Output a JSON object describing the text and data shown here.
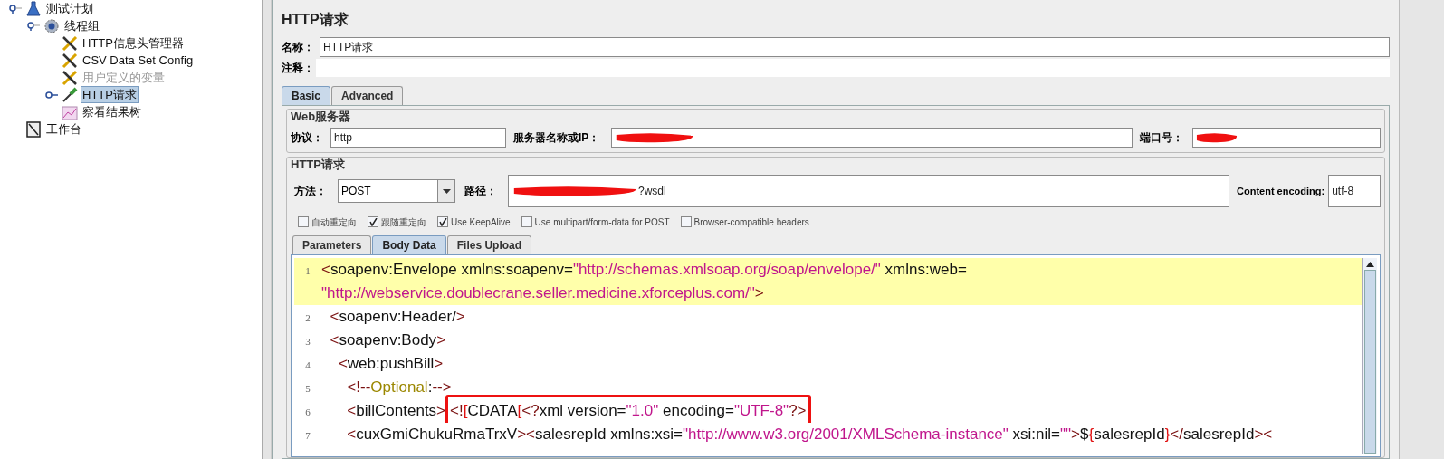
{
  "tree": [
    {
      "label": "测试计划",
      "kind": "flask",
      "expanded": true,
      "selected": false,
      "disabled": false,
      "children": [
        {
          "label": "线程组",
          "kind": "gear",
          "expanded": true,
          "selected": false,
          "disabled": false,
          "children": [
            {
              "label": "HTTP信息头管理器",
              "kind": "tools",
              "selected": false,
              "disabled": false
            },
            {
              "label": "CSV Data Set Config",
              "kind": "tools",
              "selected": false,
              "disabled": false
            },
            {
              "label": "用户定义的变量",
              "kind": "tools",
              "selected": false,
              "disabled": true
            },
            {
              "label": "HTTP请求",
              "kind": "pipette",
              "expanded": false,
              "selected": true,
              "disabled": false
            },
            {
              "label": "察看结果树",
              "kind": "chart",
              "selected": false,
              "disabled": false
            }
          ]
        }
      ]
    },
    {
      "label": "工作台",
      "kind": "notebook",
      "selected": false,
      "disabled": false
    }
  ],
  "panel": {
    "title": "HTTP请求",
    "name_label": "名称：",
    "name_value": "HTTP请求",
    "comment_label": "注释：",
    "tabs": [
      {
        "label": "Basic",
        "selected": true
      },
      {
        "label": "Advanced",
        "selected": false
      }
    ],
    "web_server": {
      "title": "Web服务器",
      "protocol_label": "协议：",
      "protocol_value": "http",
      "server_label": "服务器名称或IP：",
      "server_redacted": true,
      "port_label": "端口号：",
      "port_redacted": true
    },
    "http_request": {
      "title": "HTTP请求",
      "method_label": "方法：",
      "method_value": "POST",
      "path_label": "路径：",
      "path_redacted": true,
      "path_value": "?wsdl",
      "encoding_label": "Content encoding:",
      "encoding_value": "utf-8",
      "options": [
        {
          "label": "自动重定向",
          "checked": false
        },
        {
          "label": "跟随重定向",
          "checked": true
        },
        {
          "label": "Use KeepAlive",
          "checked": true
        },
        {
          "label": "Use multipart/form-data for POST",
          "checked": false
        },
        {
          "label": "Browser-compatible headers",
          "checked": false
        }
      ]
    },
    "sub_tabs": [
      {
        "label": "Parameters",
        "selected": false
      },
      {
        "label": "Body Data",
        "selected": true
      },
      {
        "label": "Files Upload",
        "selected": false
      }
    ],
    "editor": {
      "rows": [
        {
          "number": "1",
          "current": true,
          "segments": [
            {
              "boxed": false,
              "tokens": [
                {
                  "kind": "p",
                  "text": "<"
                },
                {
                  "kind": "t",
                  "text": "soapenv:Envelope xmlns:soapenv="
                },
                {
                  "kind": "s",
                  "text": "\"http://schemas.xmlsoap.org/soap/envelope/\""
                },
                {
                  "kind": "t",
                  "text": " xmlns:web="
                }
              ]
            }
          ]
        },
        {
          "current": true,
          "segments": [
            {
              "boxed": false,
              "tokens": [
                {
                  "kind": "s",
                  "text": "\"http://webservice.doublecrane.seller.medicine.xforceplus.com/\""
                },
                {
                  "kind": "p",
                  "text": ">"
                }
              ]
            }
          ]
        },
        {
          "number": "2",
          "current": false,
          "segments": [
            {
              "boxed": false,
              "tokens": [
                {
                  "kind": "p",
                  "text": "  <"
                },
                {
                  "kind": "t",
                  "text": "soapenv:Header/"
                },
                {
                  "kind": "p",
                  "text": ">"
                }
              ]
            }
          ]
        },
        {
          "number": "3",
          "current": false,
          "segments": [
            {
              "boxed": false,
              "tokens": [
                {
                  "kind": "p",
                  "text": "  <"
                },
                {
                  "kind": "t",
                  "text": "soapenv:Body"
                },
                {
                  "kind": "p",
                  "text": ">"
                }
              ]
            }
          ]
        },
        {
          "number": "4",
          "current": false,
          "segments": [
            {
              "boxed": false,
              "tokens": [
                {
                  "kind": "p",
                  "text": "    <"
                },
                {
                  "kind": "t",
                  "text": "web:pushBill"
                },
                {
                  "kind": "p",
                  "text": ">"
                }
              ]
            }
          ]
        },
        {
          "number": "5",
          "current": false,
          "segments": [
            {
              "boxed": false,
              "tokens": [
                {
                  "kind": "p",
                  "text": "      <!--"
                },
                {
                  "kind": "c",
                  "text": "Optional"
                },
                {
                  "kind": "t",
                  "text": ":"
                },
                {
                  "kind": "p",
                  "text": "-->"
                }
              ]
            }
          ]
        },
        {
          "number": "6",
          "current": false,
          "segments": [
            {
              "boxed": false,
              "tokens": [
                {
                  "kind": "p",
                  "text": "      <"
                },
                {
                  "kind": "t",
                  "text": "billContents"
                },
                {
                  "kind": "p",
                  "text": ">"
                }
              ]
            },
            {
              "boxed": true,
              "tokens": [
                {
                  "kind": "p",
                  "text": "<!"
                },
                {
                  "kind": "r",
                  "text": "["
                },
                {
                  "kind": "t",
                  "text": "CDATA"
                },
                {
                  "kind": "r",
                  "text": "["
                },
                {
                  "kind": "p",
                  "text": "<?"
                },
                {
                  "kind": "t",
                  "text": "xml version="
                },
                {
                  "kind": "s",
                  "text": "\"1.0\""
                },
                {
                  "kind": "t",
                  "text": " encoding="
                },
                {
                  "kind": "s",
                  "text": "\"UTF-8\""
                },
                {
                  "kind": "p",
                  "text": "?>"
                }
              ]
            }
          ]
        },
        {
          "number": "7",
          "current": false,
          "segments": [
            {
              "boxed": false,
              "tokens": [
                {
                  "kind": "p",
                  "text": "      <"
                },
                {
                  "kind": "t",
                  "text": "cuxGmiChukuRmaTrxV"
                },
                {
                  "kind": "p",
                  "text": "><"
                },
                {
                  "kind": "t",
                  "text": "salesrepId xmlns:xsi="
                },
                {
                  "kind": "s",
                  "text": "\"http://www.w3.org/2001/XMLSchema-instance\""
                },
                {
                  "kind": "t",
                  "text": " xsi:nil="
                },
                {
                  "kind": "s",
                  "text": "\"\""
                },
                {
                  "kind": "p",
                  "text": ">"
                },
                {
                  "kind": "t",
                  "text": "$"
                },
                {
                  "kind": "r",
                  "text": "{"
                },
                {
                  "kind": "t",
                  "text": "salesrepId"
                },
                {
                  "kind": "r",
                  "text": "}"
                },
                {
                  "kind": "p",
                  "text": "</"
                },
                {
                  "kind": "t",
                  "text": "salesrepId"
                },
                {
                  "kind": "p",
                  "text": "><"
                }
              ]
            }
          ]
        }
      ]
    }
  }
}
